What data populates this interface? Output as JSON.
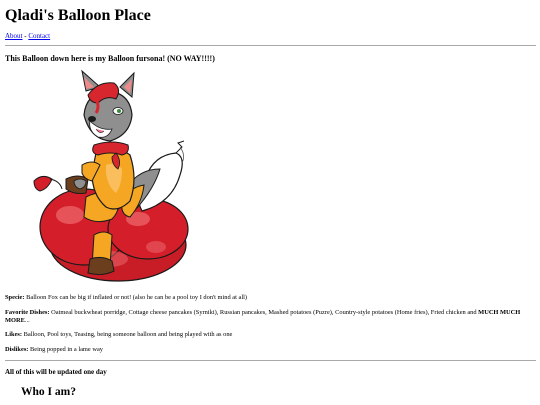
{
  "site": {
    "title": "Qladi's Balloon Place"
  },
  "nav": {
    "about": "About",
    "separator": "-",
    "contact": "Contact"
  },
  "intro": {
    "heading": "This Balloon down here is my Balloon fursona! (NO WAY!!!!)"
  },
  "colors": {
    "fur_gray": "#8f8f8f",
    "fur_orange": "#f5a623",
    "balloon_red": "#d41f2a",
    "hair_red": "#d8262f",
    "link_blue": "#0000ee"
  },
  "info": {
    "specie": {
      "label": "Specie:",
      "value": "Balloon Fox can be big if inflated or not! (also he can be a pool toy I don't mind at all)"
    },
    "dishes": {
      "label": "Favorite Dishes:",
      "value": "Oatmeal buckwheat porridge, Cottage cheese pancakes (Syrniki), Russian pancakes, Mashed potatoes (Puzre), Country-style potatoes (Home fries), Fried chicken and",
      "emphasis": "MUCH MUCH MORE",
      "suffix": "..."
    },
    "likes": {
      "label": "Likes:",
      "value": "Balloon, Pool toys, Teasing, being someone balloon and being played with as one"
    },
    "dislikes": {
      "label": "Dislikes:",
      "value": "Being popped in a lame way"
    }
  },
  "update_note": "All of this will be updated one day",
  "who": {
    "heading": "Who I am?"
  }
}
